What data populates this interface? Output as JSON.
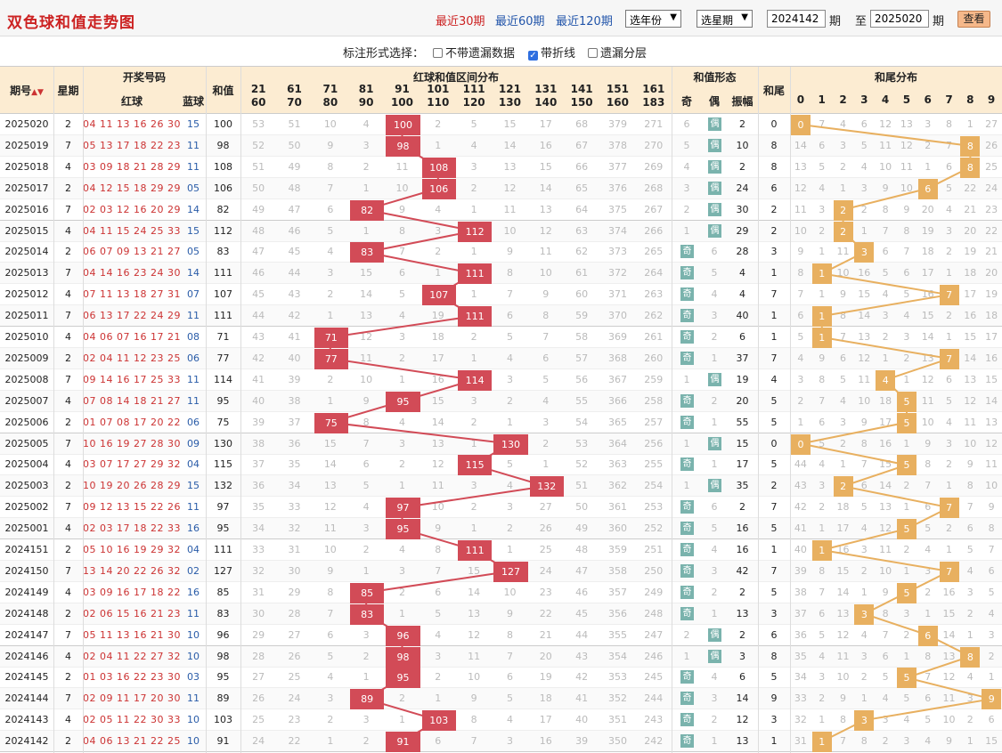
{
  "title": "双色球和值走势图",
  "range_links": [
    "最近30期",
    "最近60期",
    "最近120期"
  ],
  "year_select": "选年份",
  "star_select": "选星期",
  "from_period": "2024142",
  "period_label": "期",
  "to_label": "至",
  "to_period": "2025020",
  "period_label2": "期",
  "view_button": "查看",
  "options_label": "标注形式选择：",
  "options": [
    {
      "label": "不带遗漏数据",
      "checked": false
    },
    {
      "label": "带折线",
      "checked": true
    },
    {
      "label": "遗漏分层",
      "checked": false
    }
  ],
  "headers": {
    "period": "期号",
    "sort_icon": "sort-arrows-icon",
    "weekday": "星期",
    "winning": "开奖号码",
    "red": "红球",
    "blue": "蓝球",
    "sum": "和值",
    "interval_group": "红球和值区间分布",
    "form_group": "和值形态",
    "odd": "奇",
    "even": "偶",
    "amp": "振幅",
    "tail": "和尾",
    "tail_group": "和尾分布"
  },
  "intervals": [
    [
      "21",
      "60"
    ],
    [
      "61",
      "70"
    ],
    [
      "71",
      "80"
    ],
    [
      "81",
      "90"
    ],
    [
      "91",
      "100"
    ],
    [
      "101",
      "110"
    ],
    [
      "111",
      "120"
    ],
    [
      "121",
      "130"
    ],
    [
      "131",
      "140"
    ],
    [
      "141",
      "150"
    ],
    [
      "151",
      "160"
    ],
    [
      "161",
      "183"
    ]
  ],
  "tail_digits": [
    "0",
    "1",
    "2",
    "3",
    "4",
    "5",
    "6",
    "7",
    "8",
    "9"
  ],
  "badge_odd": "奇",
  "badge_even": "偶",
  "rows": [
    {
      "p": "2025020",
      "w": "2",
      "reds": "04 11 13 16 26 30",
      "b": "15",
      "sum": 100,
      "iv": [
        "53",
        "51",
        "10",
        "4",
        "100",
        "2",
        "5",
        "15",
        "17",
        "68",
        "379",
        "271"
      ],
      "pari": "even",
      "pv": "6",
      "amp": "2",
      "tail": 0,
      "td": [
        "0",
        "7",
        "4",
        "6",
        "12",
        "13",
        "3",
        "8",
        "1",
        "27"
      ]
    },
    {
      "p": "2025019",
      "w": "7",
      "reds": "05 13 17 18 22 23",
      "b": "11",
      "sum": 98,
      "iv": [
        "52",
        "50",
        "9",
        "3",
        "98",
        "1",
        "4",
        "14",
        "16",
        "67",
        "378",
        "270"
      ],
      "pari": "even",
      "pv": "5",
      "amp": "10",
      "tail": 8,
      "td": [
        "14",
        "6",
        "3",
        "5",
        "11",
        "12",
        "2",
        "7",
        "8",
        "26"
      ]
    },
    {
      "p": "2025018",
      "w": "4",
      "reds": "03 09 18 21 28 29",
      "b": "11",
      "sum": 108,
      "iv": [
        "51",
        "49",
        "8",
        "2",
        "11",
        "108",
        "3",
        "13",
        "15",
        "66",
        "377",
        "269"
      ],
      "pari": "even",
      "pv": "4",
      "amp": "2",
      "tail": 8,
      "td": [
        "13",
        "5",
        "2",
        "4",
        "10",
        "11",
        "1",
        "6",
        "8",
        "25"
      ]
    },
    {
      "p": "2025017",
      "w": "2",
      "reds": "04 12 15 18 29 29",
      "b": "05",
      "sum": 106,
      "iv": [
        "50",
        "48",
        "7",
        "1",
        "10",
        "106",
        "2",
        "12",
        "14",
        "65",
        "376",
        "268"
      ],
      "pari": "even",
      "pv": "3",
      "amp": "24",
      "tail": 6,
      "td": [
        "12",
        "4",
        "1",
        "3",
        "9",
        "10",
        "6",
        "5",
        "22",
        "24"
      ]
    },
    {
      "p": "2025016",
      "w": "7",
      "reds": "02 03 12 16 20 29",
      "b": "14",
      "sum": 82,
      "iv": [
        "49",
        "47",
        "6",
        "82",
        "9",
        "4",
        "1",
        "11",
        "13",
        "64",
        "375",
        "267"
      ],
      "pari": "even",
      "pv": "2",
      "amp": "30",
      "tail": 2,
      "td": [
        "11",
        "3",
        "2",
        "2",
        "8",
        "9",
        "20",
        "4",
        "21",
        "23"
      ]
    },
    {
      "p": "2025015",
      "w": "4",
      "reds": "04 11 15 24 25 33",
      "b": "15",
      "sum": 112,
      "iv": [
        "48",
        "46",
        "5",
        "1",
        "8",
        "3",
        "112",
        "10",
        "12",
        "63",
        "374",
        "266"
      ],
      "pari": "even",
      "pv": "1",
      "amp": "29",
      "tail": 2,
      "td": [
        "10",
        "2",
        "2",
        "1",
        "7",
        "8",
        "19",
        "3",
        "20",
        "22"
      ]
    },
    {
      "p": "2025014",
      "w": "2",
      "reds": "06 07 09 13 21 27",
      "b": "05",
      "sum": 83,
      "iv": [
        "47",
        "45",
        "4",
        "83",
        "7",
        "2",
        "1",
        "9",
        "11",
        "62",
        "373",
        "265"
      ],
      "pari": "odd",
      "pv": "6",
      "amp": "28",
      "tail": 3,
      "td": [
        "9",
        "1",
        "11",
        "3",
        "6",
        "7",
        "18",
        "2",
        "19",
        "21"
      ]
    },
    {
      "p": "2025013",
      "w": "7",
      "reds": "04 14 16 23 24 30",
      "b": "14",
      "sum": 111,
      "iv": [
        "46",
        "44",
        "3",
        "15",
        "6",
        "1",
        "111",
        "8",
        "10",
        "61",
        "372",
        "264"
      ],
      "pari": "odd",
      "pv": "5",
      "amp": "4",
      "tail": 1,
      "td": [
        "8",
        "1",
        "10",
        "16",
        "5",
        "6",
        "17",
        "1",
        "18",
        "20"
      ]
    },
    {
      "p": "2025012",
      "w": "4",
      "reds": "07 11 13 18 27 31",
      "b": "07",
      "sum": 107,
      "iv": [
        "45",
        "43",
        "2",
        "14",
        "5",
        "107",
        "1",
        "7",
        "9",
        "60",
        "371",
        "263"
      ],
      "pari": "odd",
      "pv": "4",
      "amp": "4",
      "tail": 7,
      "td": [
        "7",
        "1",
        "9",
        "15",
        "4",
        "5",
        "16",
        "7",
        "17",
        "19"
      ]
    },
    {
      "p": "2025011",
      "w": "7",
      "reds": "06 13 17 22 24 29",
      "b": "11",
      "sum": 111,
      "iv": [
        "44",
        "42",
        "1",
        "13",
        "4",
        "19",
        "111",
        "6",
        "8",
        "59",
        "370",
        "262"
      ],
      "pari": "odd",
      "pv": "3",
      "amp": "40",
      "tail": 1,
      "td": [
        "6",
        "1",
        "8",
        "14",
        "3",
        "4",
        "15",
        "2",
        "16",
        "18"
      ]
    },
    {
      "p": "2025010",
      "w": "4",
      "reds": "04 06 07 16 17 21",
      "b": "08",
      "sum": 71,
      "iv": [
        "43",
        "41",
        "71",
        "12",
        "3",
        "18",
        "2",
        "5",
        "7",
        "58",
        "369",
        "261"
      ],
      "pari": "odd",
      "pv": "2",
      "amp": "6",
      "tail": 1,
      "td": [
        "5",
        "1",
        "7",
        "13",
        "2",
        "3",
        "14",
        "1",
        "15",
        "17"
      ]
    },
    {
      "p": "2025009",
      "w": "2",
      "reds": "02 04 11 12 23 25",
      "b": "06",
      "sum": 77,
      "iv": [
        "42",
        "40",
        "77",
        "11",
        "2",
        "17",
        "1",
        "4",
        "6",
        "57",
        "368",
        "260"
      ],
      "pari": "odd",
      "pv": "1",
      "amp": "37",
      "tail": 7,
      "td": [
        "4",
        "9",
        "6",
        "12",
        "1",
        "2",
        "13",
        "7",
        "14",
        "16"
      ]
    },
    {
      "p": "2025008",
      "w": "7",
      "reds": "09 14 16 17 25 33",
      "b": "11",
      "sum": 114,
      "iv": [
        "41",
        "39",
        "2",
        "10",
        "1",
        "16",
        "114",
        "3",
        "5",
        "56",
        "367",
        "259"
      ],
      "pari": "even",
      "pv": "1",
      "amp": "19",
      "tail": 4,
      "td": [
        "3",
        "8",
        "5",
        "11",
        "4",
        "1",
        "12",
        "6",
        "13",
        "15"
      ]
    },
    {
      "p": "2025007",
      "w": "4",
      "reds": "07 08 14 18 21 27",
      "b": "11",
      "sum": 95,
      "iv": [
        "40",
        "38",
        "1",
        "9",
        "95",
        "15",
        "3",
        "2",
        "4",
        "55",
        "366",
        "258"
      ],
      "pari": "odd",
      "pv": "2",
      "amp": "20",
      "tail": 5,
      "td": [
        "2",
        "7",
        "4",
        "10",
        "18",
        "5",
        "11",
        "5",
        "12",
        "14"
      ]
    },
    {
      "p": "2025006",
      "w": "2",
      "reds": "01 07 08 17 20 22",
      "b": "06",
      "sum": 75,
      "iv": [
        "39",
        "37",
        "75",
        "8",
        "4",
        "14",
        "2",
        "1",
        "3",
        "54",
        "365",
        "257"
      ],
      "pari": "odd",
      "pv": "1",
      "amp": "55",
      "tail": 5,
      "td": [
        "1",
        "6",
        "3",
        "9",
        "17",
        "5",
        "10",
        "4",
        "11",
        "13"
      ]
    },
    {
      "p": "2025005",
      "w": "7",
      "reds": "10 16 19 27 28 30",
      "b": "09",
      "sum": 130,
      "iv": [
        "38",
        "36",
        "15",
        "7",
        "3",
        "13",
        "1",
        "130",
        "2",
        "53",
        "364",
        "256"
      ],
      "pari": "even",
      "pv": "1",
      "amp": "15",
      "tail": 0,
      "td": [
        "0",
        "5",
        "2",
        "8",
        "16",
        "1",
        "9",
        "3",
        "10",
        "12"
      ]
    },
    {
      "p": "2025004",
      "w": "4",
      "reds": "03 07 17 27 29 32",
      "b": "04",
      "sum": 115,
      "iv": [
        "37",
        "35",
        "14",
        "6",
        "2",
        "12",
        "115",
        "5",
        "1",
        "52",
        "363",
        "255"
      ],
      "pari": "odd",
      "pv": "1",
      "amp": "17",
      "tail": 5,
      "td": [
        "44",
        "4",
        "1",
        "7",
        "15",
        "5",
        "8",
        "2",
        "9",
        "11"
      ]
    },
    {
      "p": "2025003",
      "w": "2",
      "reds": "10 19 20 26 28 29",
      "b": "15",
      "sum": 132,
      "iv": [
        "36",
        "34",
        "13",
        "5",
        "1",
        "11",
        "3",
        "4",
        "132",
        "51",
        "362",
        "254"
      ],
      "pari": "even",
      "pv": "1",
      "amp": "35",
      "tail": 2,
      "td": [
        "43",
        "3",
        "2",
        "6",
        "14",
        "2",
        "7",
        "1",
        "8",
        "10"
      ]
    },
    {
      "p": "2025002",
      "w": "7",
      "reds": "09 12 13 15 22 26",
      "b": "11",
      "sum": 97,
      "iv": [
        "35",
        "33",
        "12",
        "4",
        "97",
        "10",
        "2",
        "3",
        "27",
        "50",
        "361",
        "253"
      ],
      "pari": "odd",
      "pv": "6",
      "amp": "2",
      "tail": 7,
      "td": [
        "42",
        "2",
        "18",
        "5",
        "13",
        "1",
        "6",
        "7",
        "7",
        "9"
      ]
    },
    {
      "p": "2025001",
      "w": "4",
      "reds": "02 03 17 18 22 33",
      "b": "16",
      "sum": 95,
      "iv": [
        "34",
        "32",
        "11",
        "3",
        "95",
        "9",
        "1",
        "2",
        "26",
        "49",
        "360",
        "252"
      ],
      "pari": "odd",
      "pv": "5",
      "amp": "16",
      "tail": 5,
      "td": [
        "41",
        "1",
        "17",
        "4",
        "12",
        "5",
        "5",
        "2",
        "6",
        "8"
      ]
    },
    {
      "p": "2024151",
      "w": "2",
      "reds": "05 10 16 19 29 32",
      "b": "04",
      "sum": 111,
      "iv": [
        "33",
        "31",
        "10",
        "2",
        "4",
        "8",
        "111",
        "1",
        "25",
        "48",
        "359",
        "251"
      ],
      "pari": "odd",
      "pv": "4",
      "amp": "16",
      "tail": 1,
      "td": [
        "40",
        "1",
        "16",
        "3",
        "11",
        "2",
        "4",
        "1",
        "5",
        "7"
      ]
    },
    {
      "p": "2024150",
      "w": "7",
      "reds": "13 14 20 22 26 32",
      "b": "02",
      "sum": 127,
      "iv": [
        "32",
        "30",
        "9",
        "1",
        "3",
        "7",
        "15",
        "127",
        "24",
        "47",
        "358",
        "250"
      ],
      "pari": "odd",
      "pv": "3",
      "amp": "42",
      "tail": 7,
      "td": [
        "39",
        "8",
        "15",
        "2",
        "10",
        "1",
        "3",
        "7",
        "4",
        "6"
      ]
    },
    {
      "p": "2024149",
      "w": "4",
      "reds": "03 09 16 17 18 22",
      "b": "16",
      "sum": 85,
      "iv": [
        "31",
        "29",
        "8",
        "85",
        "2",
        "6",
        "14",
        "10",
        "23",
        "46",
        "357",
        "249"
      ],
      "pari": "odd",
      "pv": "2",
      "amp": "2",
      "tail": 5,
      "td": [
        "38",
        "7",
        "14",
        "1",
        "9",
        "5",
        "2",
        "16",
        "3",
        "5"
      ]
    },
    {
      "p": "2024148",
      "w": "2",
      "reds": "02 06 15 16 21 23",
      "b": "11",
      "sum": 83,
      "iv": [
        "30",
        "28",
        "7",
        "83",
        "1",
        "5",
        "13",
        "9",
        "22",
        "45",
        "356",
        "248"
      ],
      "pari": "odd",
      "pv": "1",
      "amp": "13",
      "tail": 3,
      "td": [
        "37",
        "6",
        "13",
        "3",
        "8",
        "3",
        "1",
        "15",
        "2",
        "4"
      ]
    },
    {
      "p": "2024147",
      "w": "7",
      "reds": "05 11 13 16 21 30",
      "b": "10",
      "sum": 96,
      "iv": [
        "29",
        "27",
        "6",
        "3",
        "96",
        "4",
        "12",
        "8",
        "21",
        "44",
        "355",
        "247"
      ],
      "pari": "even",
      "pv": "2",
      "amp": "2",
      "tail": 6,
      "td": [
        "36",
        "5",
        "12",
        "4",
        "7",
        "2",
        "6",
        "14",
        "1",
        "3"
      ]
    },
    {
      "p": "2024146",
      "w": "4",
      "reds": "02 04 11 22 27 32",
      "b": "10",
      "sum": 98,
      "iv": [
        "28",
        "26",
        "5",
        "2",
        "98",
        "3",
        "11",
        "7",
        "20",
        "43",
        "354",
        "246"
      ],
      "pari": "even",
      "pv": "1",
      "amp": "3",
      "tail": 8,
      "td": [
        "35",
        "4",
        "11",
        "3",
        "6",
        "1",
        "8",
        "13",
        "8",
        "2"
      ]
    },
    {
      "p": "2024145",
      "w": "2",
      "reds": "01 03 16 22 23 30",
      "b": "03",
      "sum": 95,
      "iv": [
        "27",
        "25",
        "4",
        "1",
        "95",
        "2",
        "10",
        "6",
        "19",
        "42",
        "353",
        "245"
      ],
      "pari": "odd",
      "pv": "4",
      "amp": "6",
      "tail": 5,
      "td": [
        "34",
        "3",
        "10",
        "2",
        "5",
        "5",
        "7",
        "12",
        "4",
        "1"
      ]
    },
    {
      "p": "2024144",
      "w": "7",
      "reds": "02 09 11 17 20 30",
      "b": "11",
      "sum": 89,
      "iv": [
        "26",
        "24",
        "3",
        "89",
        "2",
        "1",
        "9",
        "5",
        "18",
        "41",
        "352",
        "244"
      ],
      "pari": "odd",
      "pv": "3",
      "amp": "14",
      "tail": 9,
      "td": [
        "33",
        "2",
        "9",
        "1",
        "4",
        "5",
        "6",
        "11",
        "3",
        "9"
      ]
    },
    {
      "p": "2024143",
      "w": "4",
      "reds": "02 05 11 22 30 33",
      "b": "10",
      "sum": 103,
      "iv": [
        "25",
        "23",
        "2",
        "3",
        "1",
        "103",
        "8",
        "4",
        "17",
        "40",
        "351",
        "243"
      ],
      "pari": "odd",
      "pv": "2",
      "amp": "12",
      "tail": 3,
      "td": [
        "32",
        "1",
        "8",
        "3",
        "3",
        "4",
        "5",
        "10",
        "2",
        "6"
      ]
    },
    {
      "p": "2024142",
      "w": "2",
      "reds": "04 06 13 21 22 25",
      "b": "10",
      "sum": 91,
      "iv": [
        "24",
        "22",
        "1",
        "2",
        "91",
        "6",
        "7",
        "3",
        "16",
        "39",
        "350",
        "242"
      ],
      "pari": "odd",
      "pv": "1",
      "amp": "13",
      "tail": 1,
      "td": [
        "31",
        "1",
        "7",
        "8",
        "2",
        "3",
        "4",
        "9",
        "1",
        "15"
      ]
    }
  ]
}
